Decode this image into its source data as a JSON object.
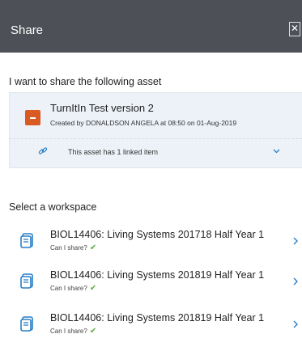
{
  "header": {
    "title": "Share",
    "close_icon": "close-icon"
  },
  "asset_section": {
    "title": "I want to share the following asset",
    "asset": {
      "icon": "document-icon",
      "name": "TurnItIn Test version 2",
      "meta": "Created by DONALDSON ANGELA at 08:50 on 01-Aug-2019"
    },
    "linked": {
      "icon": "link-icon",
      "text": "This asset has 1 linked item",
      "toggle_icon": "chevron-down-icon"
    }
  },
  "workspace_section": {
    "title": "Select a workspace",
    "items": [
      {
        "name": "BIOL14406: Living Systems 201718 Half Year 1",
        "share_label": "Can I share?",
        "share_check": "✔"
      },
      {
        "name": "BIOL14406: Living Systems 201819 Half Year 1",
        "share_label": "Can I share?",
        "share_check": "✔"
      },
      {
        "name": "BIOL14406: Living Systems 201819 Half Year 1",
        "share_label": "Can I share?",
        "share_check": "✔"
      }
    ]
  },
  "colors": {
    "header_bg": "#4d5157",
    "asset_bg": "#edf2f8",
    "accent_blue": "#2a7fc6",
    "asset_icon": "#d95b23",
    "check_green": "#5fae3c"
  }
}
